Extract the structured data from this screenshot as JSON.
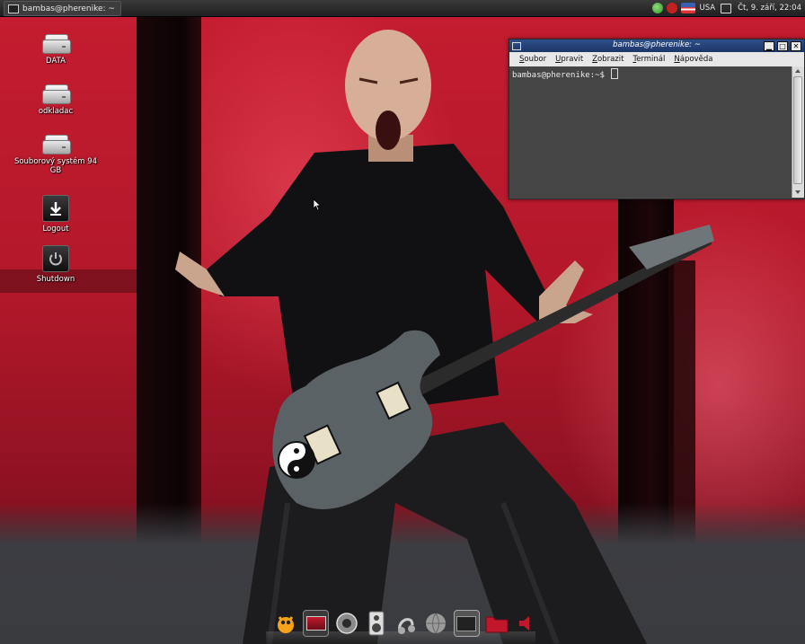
{
  "top_panel": {
    "task_button_label": "bambas@pherenike: ~",
    "tray": {
      "keyboard_layout": "USA",
      "clock": "Čt,  9. září, 22:04",
      "icons": [
        "network-icon",
        "accessibility-icon",
        "keyboard-flag-icon",
        "window-list-icon"
      ]
    }
  },
  "desktop_icons": [
    {
      "label": "DATA",
      "icon": "drive-icon"
    },
    {
      "label": "odkladac",
      "icon": "drive-icon"
    },
    {
      "label": "Souborový systém 94 GB",
      "icon": "drive-icon"
    },
    {
      "label": "Logout",
      "icon": "logout-icon"
    },
    {
      "label": "Shutdown",
      "icon": "power-icon"
    }
  ],
  "terminal": {
    "title": "bambas@pherenike: ~",
    "menu": [
      "Soubor",
      "Upravit",
      "Zobrazit",
      "Terminál",
      "Nápověda"
    ],
    "prompt": "bambas@pherenike:~$ ",
    "window_buttons": [
      "minimize",
      "maximize",
      "close"
    ]
  },
  "dock": {
    "items": [
      "gimp-icon",
      "video-player-icon",
      "web-browser-icon",
      "speaker-icon",
      "audio-editor-icon",
      "globe-icon",
      "terminal-icon",
      "folder-icon",
      "volume-icon"
    ]
  },
  "colors": {
    "wallpaper_red": "#c51c30",
    "panel_dark": "#1f1f1f",
    "terminal_title_blue": "#1d3668",
    "terminal_bg": "#454545"
  }
}
